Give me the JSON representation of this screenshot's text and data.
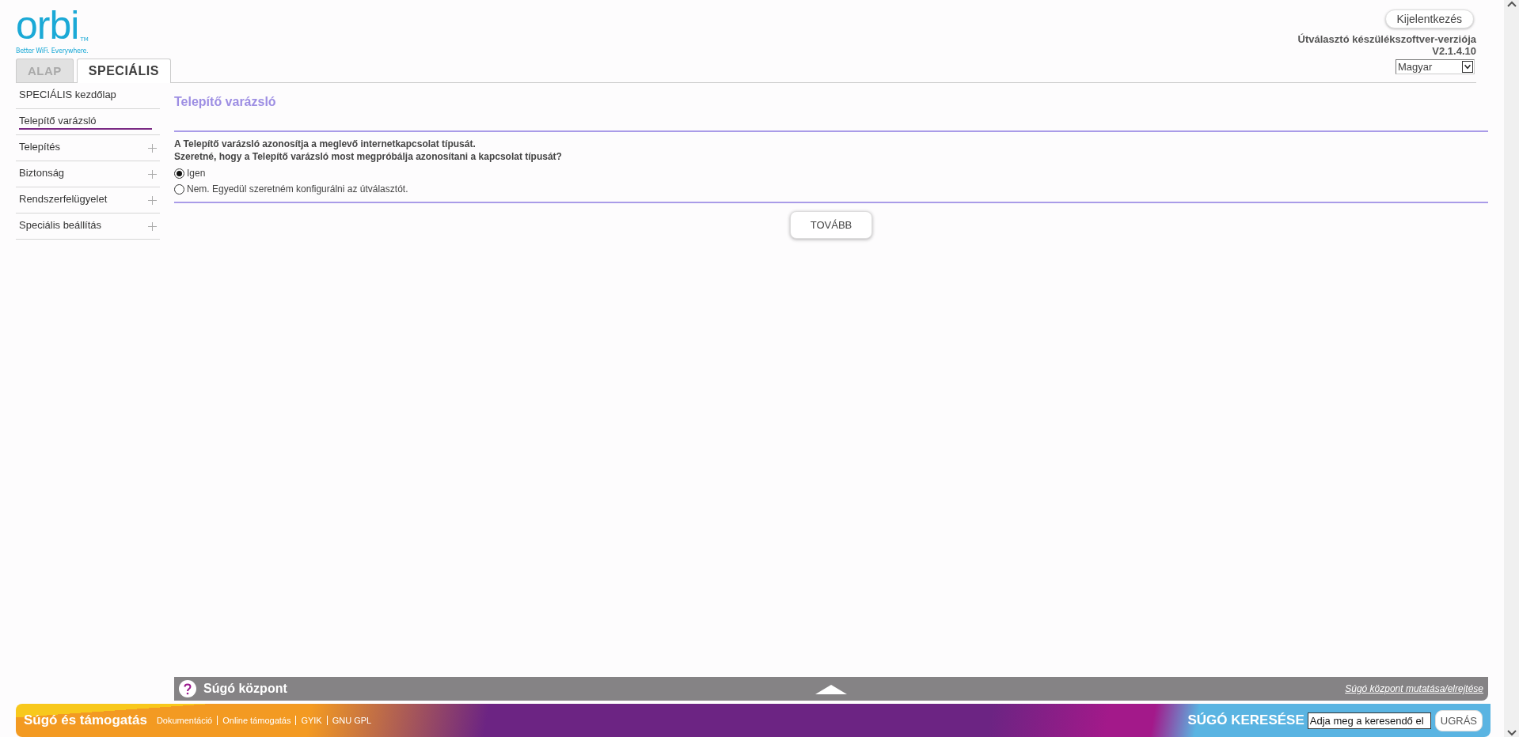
{
  "logo": {
    "wordmark": "orbi",
    "trademark": "TM",
    "tagline": "Better WiFi. Everywhere."
  },
  "tabs": [
    {
      "label": "ALAP",
      "selected": false
    },
    {
      "label": "SPECIÁLIS",
      "selected": true
    }
  ],
  "header": {
    "logout_button": "Kijelentkezés",
    "firmware_label": "Útválasztó készülékszoftver-verziója",
    "firmware_version": "V2.1.4.10",
    "language": "Magyar"
  },
  "sidebar": {
    "items": [
      {
        "label": "SPECIÁLIS kezdőlap",
        "kind": "link",
        "selected": false
      },
      {
        "label": "Telepítő varázsló",
        "kind": "link",
        "selected": true
      },
      {
        "label": "Telepítés",
        "kind": "group",
        "selected": false,
        "expanded": false
      },
      {
        "label": "Biztonság",
        "kind": "group",
        "selected": false,
        "expanded": false
      },
      {
        "label": "Rendszerfelügyelet",
        "kind": "group",
        "selected": false,
        "expanded": false
      },
      {
        "label": "Speciális beállítás",
        "kind": "group",
        "selected": false,
        "expanded": false
      }
    ]
  },
  "content": {
    "title": "Telepítő varázsló",
    "description": [
      "A Telepítő varázsló azonosítja a meglevő internetkapcsolat típusát.",
      "Szeretné, hogy a Telepítő varázsló most megpróbálja azonosítani a kapcsolat típusát?"
    ],
    "options": [
      {
        "label": "Igen",
        "selected": true
      },
      {
        "label": "Nem. Egyedül szeretném konfigurálni az útválasztót.",
        "selected": false
      }
    ],
    "next_button": "TOVÁBB"
  },
  "help_center": {
    "title": "Súgó központ",
    "toggle_link": "Súgó központ mutatása/elrejtése"
  },
  "footer": {
    "title": "Súgó és támogatás",
    "links": [
      "Dokumentáció",
      "Online támogatás",
      "GYIK",
      "GNU GPL"
    ],
    "search_label": "SÚGÓ KERESÉSE",
    "search_value": "Adja meg a keresendő el",
    "search_button": "UGRÁS"
  }
}
